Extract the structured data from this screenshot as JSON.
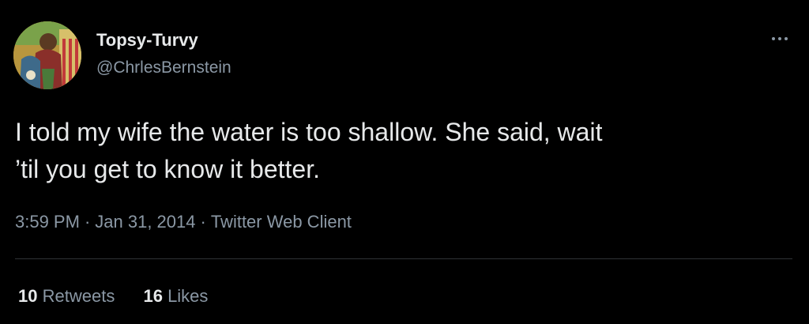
{
  "tweet": {
    "author": {
      "display_name": "Topsy-Turvy",
      "handle": "@ChrlesBernstein"
    },
    "text_line1": "I told my wife the water is too shallow. She said, wait",
    "text_line2": "’til you get to know it better.",
    "time": "3:59 PM",
    "date": "Jan 31, 2014",
    "separator": "·",
    "source": "Twitter Web Client",
    "stats": {
      "retweets_count": "10",
      "retweets_label": "Retweets",
      "likes_count": "16",
      "likes_label": "Likes"
    }
  },
  "icons": {
    "more": "more-horizontal-icon"
  },
  "colors": {
    "background": "#000000",
    "primary_text": "#e7e9ea",
    "secondary_text": "#8b98a5",
    "divider": "#2f3336"
  }
}
